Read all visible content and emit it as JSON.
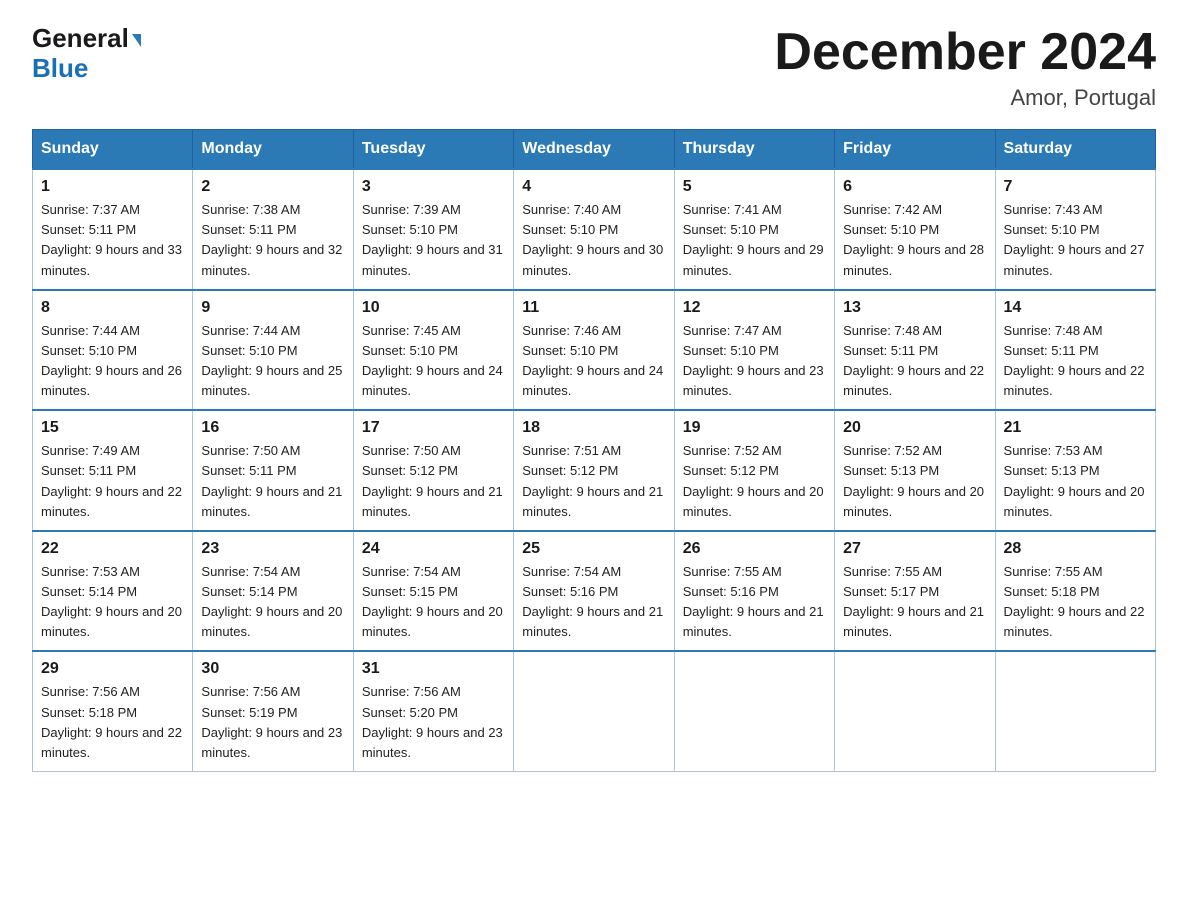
{
  "logo": {
    "line1": "General",
    "line2": "Blue"
  },
  "title": "December 2024",
  "location": "Amor, Portugal",
  "header_days": [
    "Sunday",
    "Monday",
    "Tuesday",
    "Wednesday",
    "Thursday",
    "Friday",
    "Saturday"
  ],
  "weeks": [
    [
      {
        "day": "1",
        "sunrise": "Sunrise: 7:37 AM",
        "sunset": "Sunset: 5:11 PM",
        "daylight": "Daylight: 9 hours and 33 minutes."
      },
      {
        "day": "2",
        "sunrise": "Sunrise: 7:38 AM",
        "sunset": "Sunset: 5:11 PM",
        "daylight": "Daylight: 9 hours and 32 minutes."
      },
      {
        "day": "3",
        "sunrise": "Sunrise: 7:39 AM",
        "sunset": "Sunset: 5:10 PM",
        "daylight": "Daylight: 9 hours and 31 minutes."
      },
      {
        "day": "4",
        "sunrise": "Sunrise: 7:40 AM",
        "sunset": "Sunset: 5:10 PM",
        "daylight": "Daylight: 9 hours and 30 minutes."
      },
      {
        "day": "5",
        "sunrise": "Sunrise: 7:41 AM",
        "sunset": "Sunset: 5:10 PM",
        "daylight": "Daylight: 9 hours and 29 minutes."
      },
      {
        "day": "6",
        "sunrise": "Sunrise: 7:42 AM",
        "sunset": "Sunset: 5:10 PM",
        "daylight": "Daylight: 9 hours and 28 minutes."
      },
      {
        "day": "7",
        "sunrise": "Sunrise: 7:43 AM",
        "sunset": "Sunset: 5:10 PM",
        "daylight": "Daylight: 9 hours and 27 minutes."
      }
    ],
    [
      {
        "day": "8",
        "sunrise": "Sunrise: 7:44 AM",
        "sunset": "Sunset: 5:10 PM",
        "daylight": "Daylight: 9 hours and 26 minutes."
      },
      {
        "day": "9",
        "sunrise": "Sunrise: 7:44 AM",
        "sunset": "Sunset: 5:10 PM",
        "daylight": "Daylight: 9 hours and 25 minutes."
      },
      {
        "day": "10",
        "sunrise": "Sunrise: 7:45 AM",
        "sunset": "Sunset: 5:10 PM",
        "daylight": "Daylight: 9 hours and 24 minutes."
      },
      {
        "day": "11",
        "sunrise": "Sunrise: 7:46 AM",
        "sunset": "Sunset: 5:10 PM",
        "daylight": "Daylight: 9 hours and 24 minutes."
      },
      {
        "day": "12",
        "sunrise": "Sunrise: 7:47 AM",
        "sunset": "Sunset: 5:10 PM",
        "daylight": "Daylight: 9 hours and 23 minutes."
      },
      {
        "day": "13",
        "sunrise": "Sunrise: 7:48 AM",
        "sunset": "Sunset: 5:11 PM",
        "daylight": "Daylight: 9 hours and 22 minutes."
      },
      {
        "day": "14",
        "sunrise": "Sunrise: 7:48 AM",
        "sunset": "Sunset: 5:11 PM",
        "daylight": "Daylight: 9 hours and 22 minutes."
      }
    ],
    [
      {
        "day": "15",
        "sunrise": "Sunrise: 7:49 AM",
        "sunset": "Sunset: 5:11 PM",
        "daylight": "Daylight: 9 hours and 22 minutes."
      },
      {
        "day": "16",
        "sunrise": "Sunrise: 7:50 AM",
        "sunset": "Sunset: 5:11 PM",
        "daylight": "Daylight: 9 hours and 21 minutes."
      },
      {
        "day": "17",
        "sunrise": "Sunrise: 7:50 AM",
        "sunset": "Sunset: 5:12 PM",
        "daylight": "Daylight: 9 hours and 21 minutes."
      },
      {
        "day": "18",
        "sunrise": "Sunrise: 7:51 AM",
        "sunset": "Sunset: 5:12 PM",
        "daylight": "Daylight: 9 hours and 21 minutes."
      },
      {
        "day": "19",
        "sunrise": "Sunrise: 7:52 AM",
        "sunset": "Sunset: 5:12 PM",
        "daylight": "Daylight: 9 hours and 20 minutes."
      },
      {
        "day": "20",
        "sunrise": "Sunrise: 7:52 AM",
        "sunset": "Sunset: 5:13 PM",
        "daylight": "Daylight: 9 hours and 20 minutes."
      },
      {
        "day": "21",
        "sunrise": "Sunrise: 7:53 AM",
        "sunset": "Sunset: 5:13 PM",
        "daylight": "Daylight: 9 hours and 20 minutes."
      }
    ],
    [
      {
        "day": "22",
        "sunrise": "Sunrise: 7:53 AM",
        "sunset": "Sunset: 5:14 PM",
        "daylight": "Daylight: 9 hours and 20 minutes."
      },
      {
        "day": "23",
        "sunrise": "Sunrise: 7:54 AM",
        "sunset": "Sunset: 5:14 PM",
        "daylight": "Daylight: 9 hours and 20 minutes."
      },
      {
        "day": "24",
        "sunrise": "Sunrise: 7:54 AM",
        "sunset": "Sunset: 5:15 PM",
        "daylight": "Daylight: 9 hours and 20 minutes."
      },
      {
        "day": "25",
        "sunrise": "Sunrise: 7:54 AM",
        "sunset": "Sunset: 5:16 PM",
        "daylight": "Daylight: 9 hours and 21 minutes."
      },
      {
        "day": "26",
        "sunrise": "Sunrise: 7:55 AM",
        "sunset": "Sunset: 5:16 PM",
        "daylight": "Daylight: 9 hours and 21 minutes."
      },
      {
        "day": "27",
        "sunrise": "Sunrise: 7:55 AM",
        "sunset": "Sunset: 5:17 PM",
        "daylight": "Daylight: 9 hours and 21 minutes."
      },
      {
        "day": "28",
        "sunrise": "Sunrise: 7:55 AM",
        "sunset": "Sunset: 5:18 PM",
        "daylight": "Daylight: 9 hours and 22 minutes."
      }
    ],
    [
      {
        "day": "29",
        "sunrise": "Sunrise: 7:56 AM",
        "sunset": "Sunset: 5:18 PM",
        "daylight": "Daylight: 9 hours and 22 minutes."
      },
      {
        "day": "30",
        "sunrise": "Sunrise: 7:56 AM",
        "sunset": "Sunset: 5:19 PM",
        "daylight": "Daylight: 9 hours and 23 minutes."
      },
      {
        "day": "31",
        "sunrise": "Sunrise: 7:56 AM",
        "sunset": "Sunset: 5:20 PM",
        "daylight": "Daylight: 9 hours and 23 minutes."
      },
      null,
      null,
      null,
      null
    ]
  ]
}
